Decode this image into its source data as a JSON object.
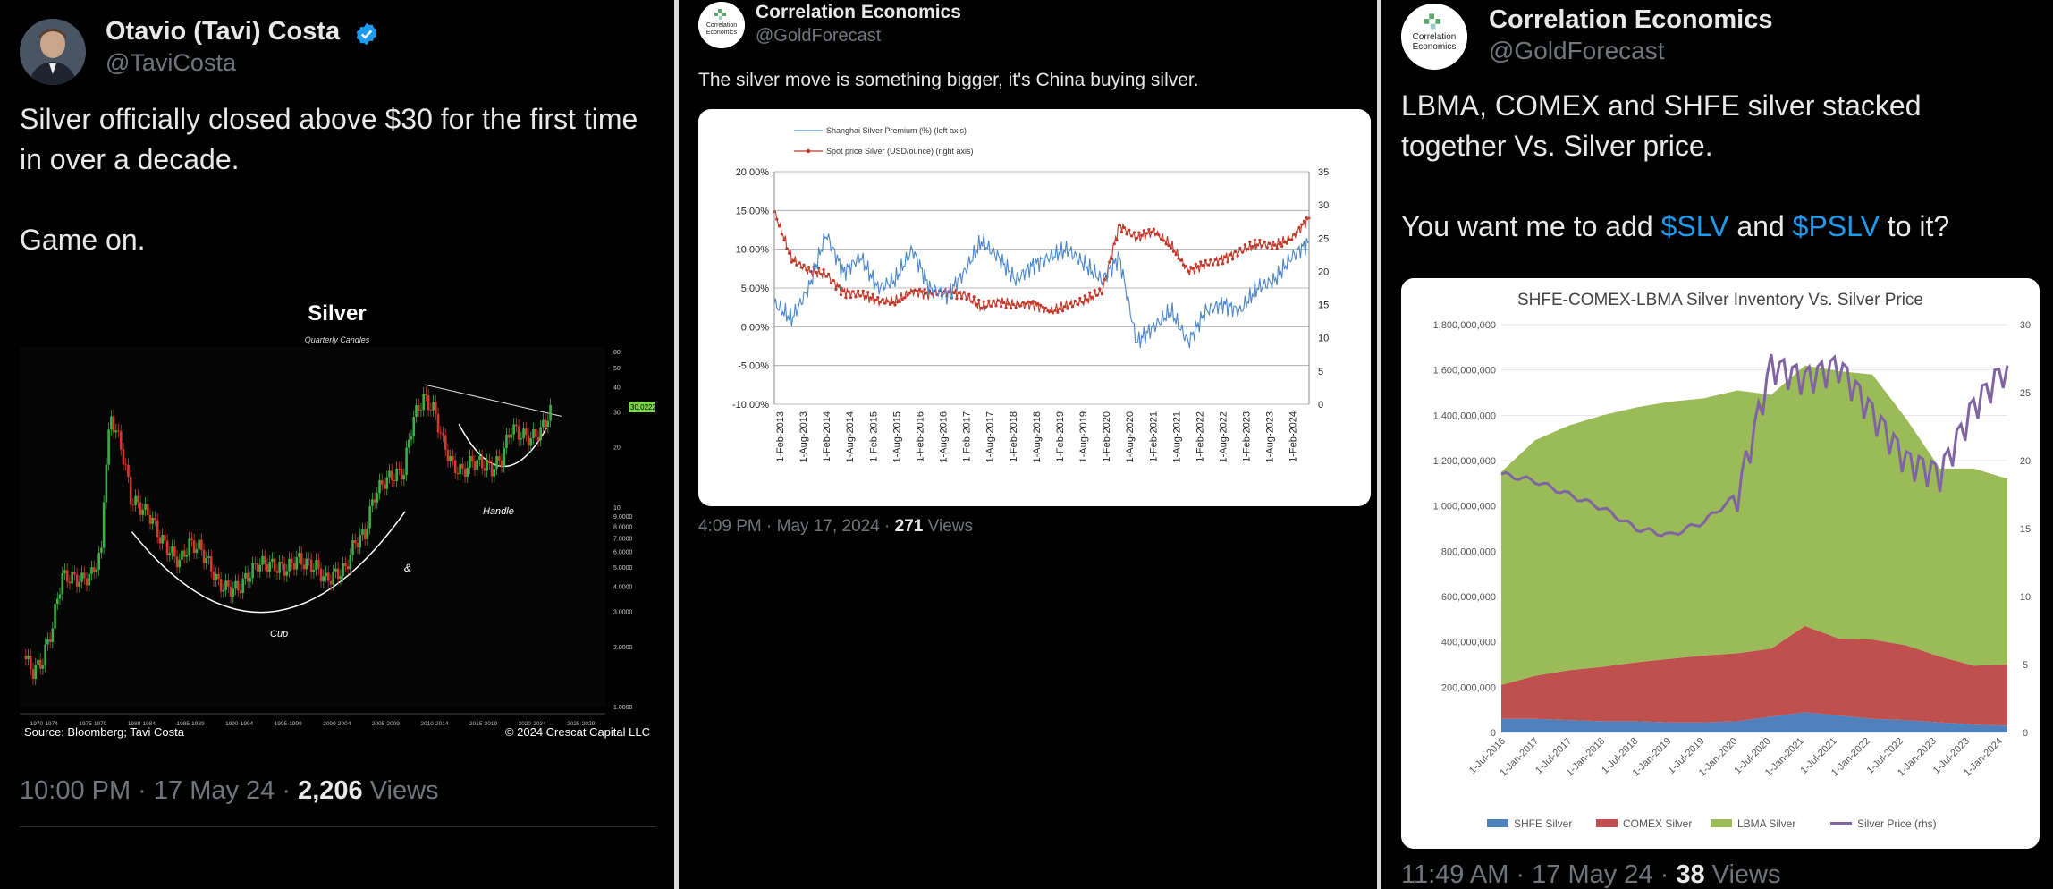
{
  "tweet1": {
    "display_name": "Otavio (Tavi) Costa",
    "handle": "@TaviCosta",
    "line1": "Silver officially closed above $30 for the first time in over a decade.",
    "line2": "Game on.",
    "time": "10:00 PM · 17 May 24 · ",
    "views_count": "2,206",
    "views_label": " Views",
    "verified_color": "#1d9bf0",
    "chart_data": {
      "type": "line",
      "title": "Silver",
      "subtitle": "Quarterly Candles",
      "x_ticks": [
        "1970-1974",
        "1975-1979",
        "1980-1984",
        "1985-1989",
        "1990-1994",
        "1995-1999",
        "2000-2004",
        "2005-2009",
        "2010-2014",
        "2015-2019",
        "2020-2024",
        "2025-2029"
      ],
      "y_ticks": [
        "60",
        "50",
        "40",
        "30",
        "20",
        "10",
        "9.0000",
        "8.0000",
        "7.0000",
        "6.0000",
        "5.0000",
        "4.0000",
        "3.0000",
        "2.0000",
        "1.0000"
      ],
      "x": [
        1970,
        1971,
        1972,
        1973,
        1974,
        1975,
        1976,
        1977,
        1978,
        1979,
        1980,
        1981,
        1982,
        1983,
        1984,
        1985,
        1986,
        1987,
        1988,
        1989,
        1990,
        1991,
        1992,
        1993,
        1994,
        1995,
        1996,
        1997,
        1998,
        1999,
        2000,
        2001,
        2002,
        2003,
        2004,
        2005,
        2006,
        2007,
        2008,
        2009,
        2010,
        2011,
        2012,
        2013,
        2014,
        2015,
        2016,
        2017,
        2018,
        2019,
        2020,
        2021,
        2022,
        2023,
        2024
      ],
      "values": [
        1.8,
        1.5,
        1.7,
        2.5,
        4.5,
        4.4,
        4.3,
        4.6,
        5.9,
        28,
        20,
        11,
        10,
        9,
        7,
        6,
        5.3,
        6.5,
        6.3,
        5.2,
        4.1,
        3.9,
        3.9,
        4.5,
        5.2,
        5.2,
        5.0,
        4.9,
        5.5,
        5.2,
        5.0,
        4.3,
        4.6,
        4.9,
        6.7,
        7.3,
        11.5,
        13.5,
        14.5,
        15,
        28,
        35,
        31,
        21,
        16,
        15,
        17,
        16.5,
        15.5,
        17.5,
        25,
        23,
        22,
        24,
        30
      ],
      "last_value_label": "30.0222",
      "annotations": [
        "Cup",
        "&",
        "Handle"
      ],
      "source": "Source: Bloomberg; Tavi Costa",
      "copyright": "© 2024 Crescat Capital LLC",
      "up_color": "#3cb043",
      "down_color": "#d23b2c"
    }
  },
  "tweet2": {
    "display_name": "Correlation Economics",
    "handle": "@GoldForecast",
    "text": "The silver move is something bigger, it's China buying silver.",
    "time": "4:09 PM · May 17, 2024 · ",
    "views_count": "271",
    "views_label": " Views",
    "logo_line1": "Correlation",
    "logo_line2": "Economics",
    "chart_data": {
      "type": "line",
      "legend_position": "top-left",
      "series": [
        {
          "name": "Shanghai Silver Premium (%) (left axis)",
          "color": "#4a86c8",
          "values": [
            0.03,
            0.01,
            0.05,
            0.12,
            0.07,
            0.09,
            0.05,
            0.06,
            0.1,
            0.05,
            0.04,
            0.07,
            0.11,
            0.09,
            0.06,
            0.08,
            0.09,
            0.1,
            0.08,
            0.06,
            0.09,
            -0.02,
            0.0,
            0.02,
            -0.02,
            0.02,
            0.03,
            0.02,
            0.05,
            0.06,
            0.09,
            0.11
          ]
        },
        {
          "name": "Spot price Silver (USD/ounce) (right axis)",
          "color": "#c0392b",
          "values": [
            29,
            22,
            20,
            19.5,
            17,
            16.5,
            15.5,
            15.5,
            17,
            16.5,
            17,
            16.5,
            14.5,
            15.5,
            15,
            15,
            14,
            15,
            15.5,
            17,
            27,
            25,
            26,
            24,
            20,
            21,
            22,
            23,
            24,
            24,
            25,
            28
          ]
        }
      ],
      "x_ticks": [
        "1-Feb-2013",
        "1-Aug-2013",
        "1-Feb-2014",
        "1-Aug-2014",
        "1-Feb-2015",
        "1-Aug-2015",
        "1-Feb-2016",
        "1-Aug-2016",
        "1-Feb-2017",
        "1-Aug-2017",
        "1-Feb-2018",
        "1-Aug-2018",
        "1-Feb-2019",
        "1-Aug-2019",
        "1-Feb-2020",
        "1-Aug-2020",
        "1-Feb-2021",
        "1-Aug-2021",
        "1-Feb-2022",
        "1-Aug-2022",
        "1-Feb-2023",
        "1-Aug-2023",
        "1-Feb-2024"
      ],
      "y_left_ticks": [
        "20.00%",
        "15.00%",
        "10.00%",
        "5.00%",
        "0.00%",
        "-5.00%",
        "-10.00%"
      ],
      "y_right_ticks": [
        "35",
        "30",
        "25",
        "20",
        "15",
        "10",
        "5",
        "0"
      ],
      "y_left_range": [
        -0.1,
        0.2
      ],
      "y_right_range": [
        0,
        35
      ]
    }
  },
  "tweet3": {
    "display_name": "Correlation Economics",
    "handle": "@GoldForecast",
    "line1": "LBMA, COMEX and SHFE silver stacked together Vs. Silver price.",
    "line2_pre": "You want me to add ",
    "tag1": "$SLV",
    "and": " and ",
    "tag2": "$PSLV",
    "line2_post": " to it?",
    "time": "11:49 AM · 17 May 24 · ",
    "views_count": "38",
    "views_label": " Views",
    "logo_line1": "Correlation",
    "logo_line2": "Economics",
    "chart_data": {
      "type": "area",
      "title": "SHFE-COMEX-LBMA Silver Inventory Vs. Silver Price",
      "legend_position": "bottom",
      "x_ticks": [
        "1-Jul-2016",
        "1-Jan-2017",
        "1-Jul-2017",
        "1-Jan-2018",
        "1-Jul-2018",
        "1-Jan-2019",
        "1-Jul-2019",
        "1-Jan-2020",
        "1-Jul-2020",
        "1-Jan-2021",
        "1-Jul-2021",
        "1-Jan-2022",
        "1-Jul-2022",
        "1-Jan-2023",
        "1-Jul-2023",
        "1-Jan-2024"
      ],
      "y_left_ticks": [
        "1,800,000,000",
        "1,600,000,000",
        "1,400,000,000",
        "1,200,000,000",
        "1,000,000,000",
        "800,000,000",
        "600,000,000",
        "400,000,000",
        "200,000,000",
        "0"
      ],
      "y_right_ticks": [
        "30",
        "25",
        "20",
        "15",
        "10",
        "5",
        "0"
      ],
      "y_left_range": [
        0,
        1800000000
      ],
      "y_right_range": [
        0,
        30
      ],
      "series": [
        {
          "name": "SHFE Silver",
          "color": "#4f81bd",
          "values": [
            60,
            60,
            55,
            50,
            50,
            45,
            45,
            50,
            70,
            90,
            75,
            60,
            55,
            45,
            35,
            30
          ]
        },
        {
          "name": "COMEX Silver",
          "color": "#c0504d",
          "values": [
            150,
            190,
            220,
            240,
            260,
            280,
            295,
            300,
            300,
            380,
            340,
            350,
            330,
            290,
            260,
            270
          ]
        },
        {
          "name": "LBMA Silver",
          "color": "#9bbb59",
          "values": [
            940,
            1040,
            1080,
            1110,
            1125,
            1135,
            1135,
            1160,
            1120,
            1150,
            1180,
            1170,
            1000,
            830,
            870,
            820
          ]
        },
        {
          "name": "Silver Price (rhs)",
          "color": "#8064a2",
          "values": [
            19,
            18.5,
            17.5,
            16.5,
            15,
            14.5,
            15.5,
            17.5,
            27,
            26,
            27,
            23.5,
            20,
            19,
            24,
            27
          ]
        }
      ]
    }
  }
}
